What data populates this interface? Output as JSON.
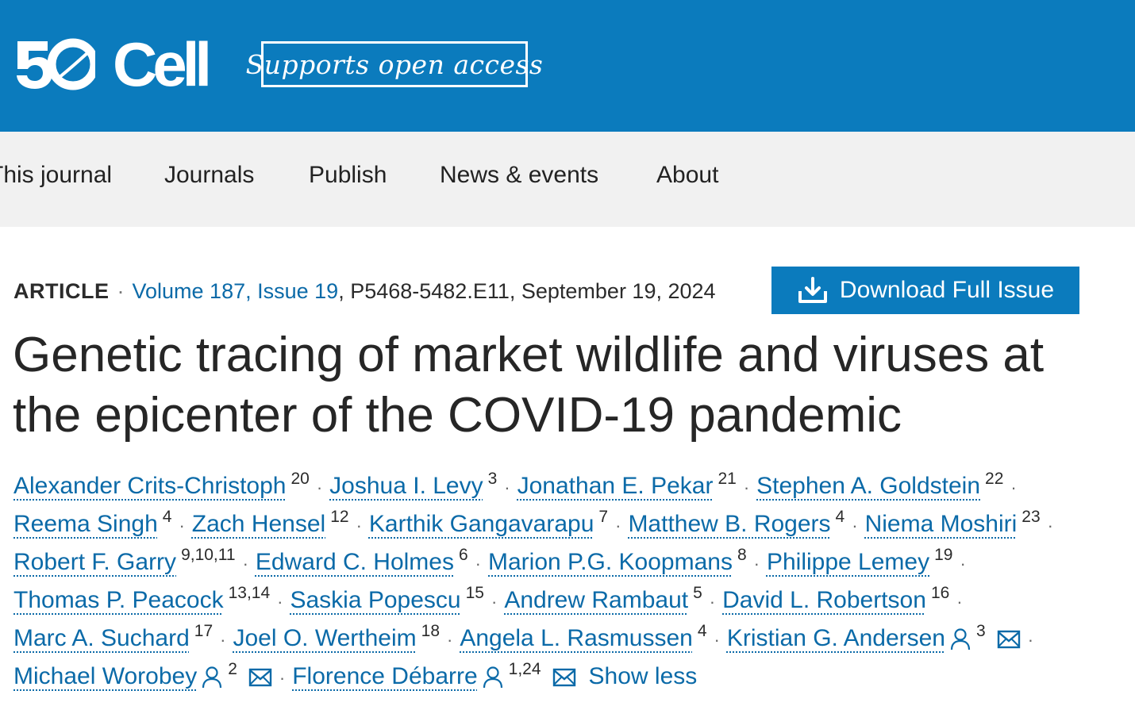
{
  "header": {
    "logo_text": "Cell",
    "logo_mark_icon": "cell-50-anniversary-logo",
    "open_access_label": "Supports open access",
    "brand_color": "#0b7bbd"
  },
  "nav": {
    "items": [
      "This journal",
      "Journals",
      "Publish",
      "News & events",
      "About"
    ]
  },
  "article": {
    "type": "ARTICLE",
    "volume_issue": "Volume 187, Issue 19",
    "pages_date": ", P5468-5482.E11, September 19, 2024",
    "download_label": "Download Full Issue",
    "download_icon": "download-icon",
    "title": "Genetic tracing of market wildlife and viruses at the epicenter of the COVID-19 pandemic"
  },
  "authors": {
    "show_less_label": "Show less",
    "list": [
      {
        "name": "Alexander Crits-Christoph",
        "aff": "20"
      },
      {
        "name": "Joshua I. Levy",
        "aff": "3"
      },
      {
        "name": "Jonathan E. Pekar",
        "aff": "21"
      },
      {
        "name": "Stephen A. Goldstein",
        "aff": "22"
      },
      {
        "name": "Reema Singh",
        "aff": "4"
      },
      {
        "name": "Zach Hensel",
        "aff": "12"
      },
      {
        "name": "Karthik Gangavarapu",
        "aff": "7"
      },
      {
        "name": "Matthew B. Rogers",
        "aff": "4"
      },
      {
        "name": "Niema Moshiri",
        "aff": "23"
      },
      {
        "name": "Robert F. Garry",
        "aff": "9,10,11"
      },
      {
        "name": "Edward C. Holmes",
        "aff": "6"
      },
      {
        "name": "Marion P.G. Koopmans",
        "aff": "8"
      },
      {
        "name": "Philippe Lemey",
        "aff": "19"
      },
      {
        "name": "Thomas P. Peacock",
        "aff": "13,14"
      },
      {
        "name": "Saskia Popescu",
        "aff": "15"
      },
      {
        "name": "Andrew Rambaut",
        "aff": "5"
      },
      {
        "name": "David L. Robertson",
        "aff": "16"
      },
      {
        "name": "Marc A. Suchard",
        "aff": "17"
      },
      {
        "name": "Joel O. Wertheim",
        "aff": "18"
      },
      {
        "name": "Angela L. Rasmussen",
        "aff": "4"
      },
      {
        "name": "Kristian G. Andersen",
        "aff": "3",
        "corresponding": true
      },
      {
        "name": "Michael Worobey",
        "aff": "2",
        "corresponding": true
      },
      {
        "name": "Florence Débarre",
        "aff": "1,24",
        "corresponding": true
      }
    ]
  }
}
